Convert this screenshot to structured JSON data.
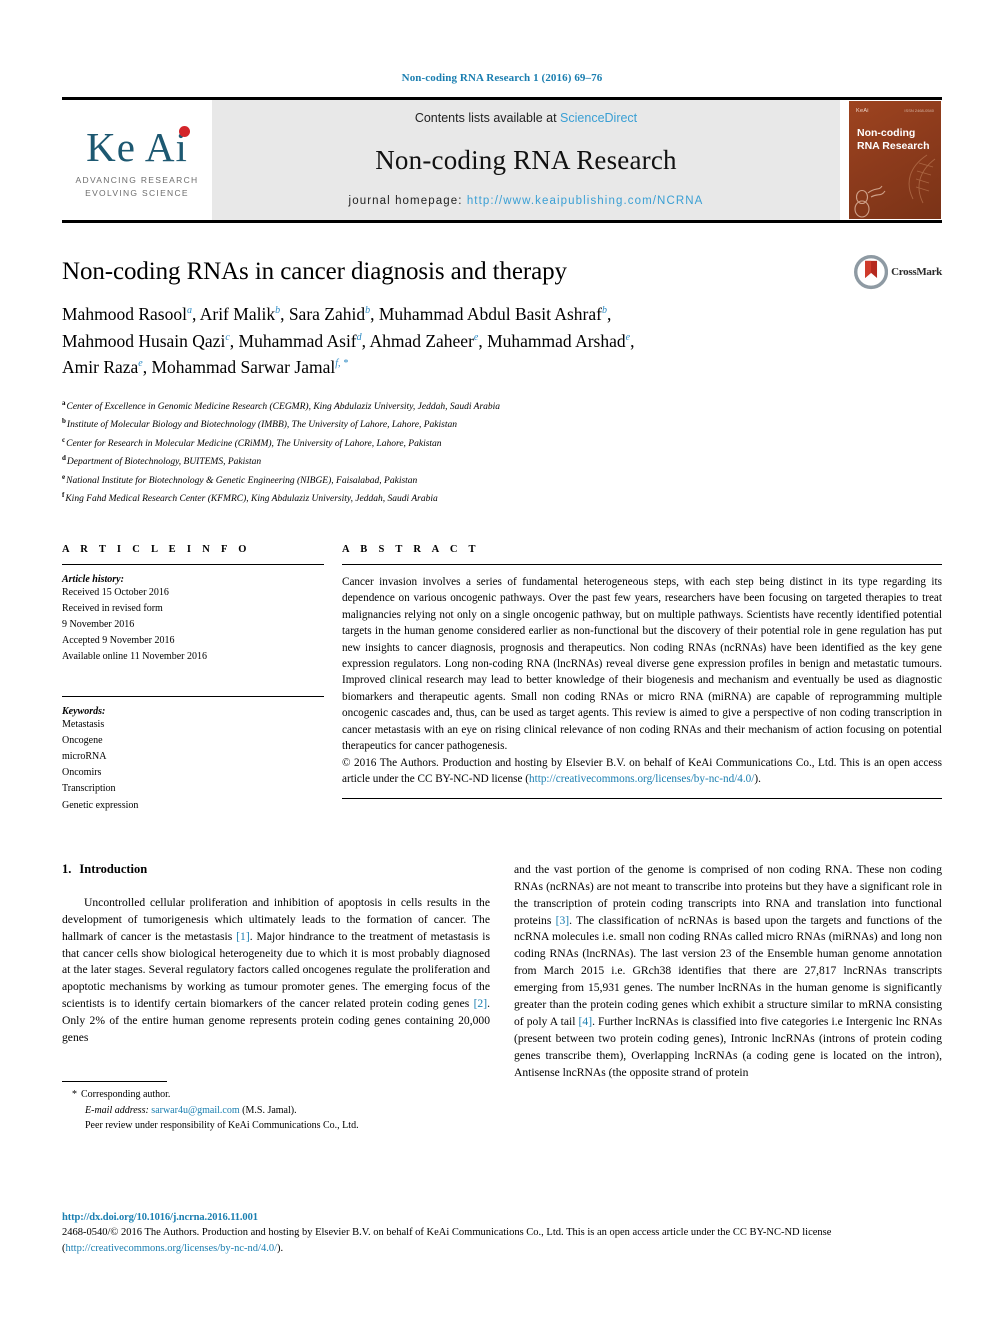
{
  "running_head": "Non-coding RNA Research 1 (2016) 69–76",
  "masthead": {
    "logo": {
      "wordmark": "Ke Ai",
      "tagline_line1": "ADVANCING RESEARCH",
      "tagline_line2": "EVOLVING SCIENCE"
    },
    "contents_prefix": "Contents lists available at ",
    "contents_link": "ScienceDirect",
    "journal_title": "Non-coding RNA Research",
    "homepage_label": "journal homepage: ",
    "homepage_url": "http://www.keaipublishing.com/NCRNA",
    "cover": {
      "publisher": "KeAi",
      "issn": "ISSN 2468-0540",
      "title": "Non-coding RNA Research"
    }
  },
  "article": {
    "title": "Non-coding RNAs in cancer diagnosis and therapy",
    "crossmark_label": "CrossMark",
    "authors_lines": [
      "Mahmood Rasool ᵃ, Arif Malik ᵇ, Sara Zahid ᵇ, Muhammad Abdul Basit Ashraf ᵇ,",
      "Mahmood Husain Qazi ᶜ, Muhammad Asif ᵈ, Ahmad Zaheer ᵉ, Muhammad Arshad ᵉ,",
      "Amir Raza ᵉ, Mohammad Sarwar Jamal ᶠ, *"
    ],
    "authors": [
      {
        "name": "Mahmood Rasool",
        "marks": "a",
        "sep": ", "
      },
      {
        "name": "Arif Malik",
        "marks": "b",
        "sep": ", "
      },
      {
        "name": "Sara Zahid",
        "marks": "b",
        "sep": ", "
      },
      {
        "name": "Muhammad Abdul Basit Ashraf",
        "marks": "b",
        "sep": ","
      },
      {
        "name": "Mahmood Husain Qazi",
        "marks": "c",
        "sep": ", "
      },
      {
        "name": "Muhammad Asif",
        "marks": "d",
        "sep": ", "
      },
      {
        "name": "Ahmad Zaheer",
        "marks": "e",
        "sep": ", "
      },
      {
        "name": "Muhammad Arshad",
        "marks": "e",
        "sep": ","
      },
      {
        "name": "Amir Raza",
        "marks": "e",
        "sep": ", "
      },
      {
        "name": "Mohammad Sarwar Jamal",
        "marks": "f, *",
        "sep": ""
      }
    ],
    "affiliations": [
      {
        "mark": "a",
        "text": "Center of Excellence in Genomic Medicine Research (CEGMR), King Abdulaziz University, Jeddah, Saudi Arabia"
      },
      {
        "mark": "b",
        "text": "Institute of Molecular Biology and Biotechnology (IMBB), The University of Lahore, Lahore, Pakistan"
      },
      {
        "mark": "c",
        "text": "Center for Research in Molecular Medicine (CRiMM), The University of Lahore, Lahore, Pakistan"
      },
      {
        "mark": "d",
        "text": "Department of Biotechnology, BUITEMS, Pakistan"
      },
      {
        "mark": "e",
        "text": "National Institute for Biotechnology & Genetic Engineering (NIBGE), Faisalabad, Pakistan"
      },
      {
        "mark": "f",
        "text": "King Fahd Medical Research Center (KFMRC), King Abdulaziz University, Jeddah, Saudi Arabia"
      }
    ]
  },
  "article_info": {
    "heading": "A R T I C L E  I N F O",
    "history_label": "Article history:",
    "history_lines": [
      "Received 15 October 2016",
      "Received in revised form",
      "9 November 2016",
      "Accepted 9 November 2016",
      "Available online 11 November 2016"
    ],
    "keywords_label": "Keywords:",
    "keywords": [
      "Metastasis",
      "Oncogene",
      "microRNA",
      "Oncomirs",
      "Transcription",
      "Genetic expression"
    ]
  },
  "abstract": {
    "heading": "A B S T R A C T",
    "text": "Cancer invasion involves a series of fundamental heterogeneous steps, with each step being distinct in its type regarding its dependence on various oncogenic pathways. Over the past few years, researchers have been focusing on targeted therapies to treat malignancies relying not only on a single oncogenic pathway, but on multiple pathways. Scientists have recently identified potential targets in the human genome considered earlier as non-functional but the discovery of their potential role in gene regulation has put new insights to cancer diagnosis, prognosis and therapeutics. Non coding RNAs (ncRNAs) have been identified as the key gene expression regulators. Long non-coding RNA (lncRNAs) reveal diverse gene expression profiles in benign and metastatic tumours. Improved clinical research may lead to better knowledge of their biogenesis and mechanism and eventually be used as diagnostic biomarkers and therapeutic agents. Small non coding RNAs or micro RNA (miRNA) are capable of reprogramming multiple oncogenic cascades and, thus, can be used as target agents. This review is aimed to give a perspective of non coding transcription in cancer metastasis with an eye on rising clinical relevance of non coding RNAs and their mechanism of action focusing on potential therapeutics for cancer pathogenesis.",
    "copyright_pre": "© 2016 The Authors. Production and hosting by Elsevier B.V. on behalf of KeAi Communications Co., Ltd. This is an open access article under the CC BY-NC-ND license (",
    "copyright_link": "http://creativecommons.org/licenses/by-nc-nd/4.0/",
    "copyright_post": ")."
  },
  "introduction": {
    "number": "1.",
    "title": "Introduction",
    "left_para_pre": "Uncontrolled cellular proliferation and inhibition of apoptosis in cells results in the development of tumorigenesis which ultimately leads to the formation of cancer. The hallmark of cancer is the metastasis ",
    "ref1": "[1]",
    "left_para_mid": ". Major hindrance to the treatment of metastasis is that cancer cells show biological heterogeneity due to which it is most probably diagnosed at the later stages. Several regulatory factors called oncogenes regulate the proliferation and apoptotic mechanisms by working as tumour promoter genes. The emerging focus of the scientists is to identify certain biomarkers of the cancer related protein coding genes ",
    "ref2": "[2]",
    "left_para_end": ". Only 2% of the entire human genome represents protein coding genes containing 20,000 genes",
    "right_para_pre": "and the vast portion of the genome is comprised of non coding RNA. These non coding RNAs (ncRNAs) are not meant to transcribe into proteins but they have a significant role in the transcription of protein coding transcripts into RNA and translation into functional proteins ",
    "ref3": "[3]",
    "right_para_mid": ". The classification of ncRNAs is based upon the targets and functions of the ncRNA molecules i.e. small non coding RNAs called micro RNAs (miRNAs) and long non coding RNAs (lncRNAs). The last version 23 of the Ensemble human genome annotation from March 2015 i.e. GRch38 identifies that there are 27,817 lncRNAs transcripts emerging from 15,931 genes. The number lncRNAs in the human genome is significantly greater than the protein coding genes which exhibit a structure similar to mRNA consisting of poly A tail ",
    "ref4": "[4]",
    "right_para_end": ". Further lncRNAs is classified into five categories i.e Intergenic lnc RNAs (present between two protein coding genes), Intronic lncRNAs (introns of protein coding genes transcribe them), Overlapping lncRNAs (a coding gene is located on the intron), Antisense lncRNAs (the opposite strand of protein"
  },
  "footnote": {
    "star": "*",
    "corresponding": "Corresponding author.",
    "email_label": "E-mail address:",
    "email": "sarwar4u@gmail.com",
    "email_suffix": "(M.S. Jamal).",
    "peer_review": "Peer review under responsibility of KeAi Communications Co., Ltd."
  },
  "page_footer": {
    "doi": "http://dx.doi.org/10.1016/j.ncrna.2016.11.001",
    "legal_pre": "2468-0540/© 2016 The Authors. Production and hosting by Elsevier B.V. on behalf of KeAi Communications Co., Ltd. This is an open access article under the CC BY-NC-ND license (",
    "legal_link": "http://creativecommons.org/licenses/by-nc-nd/4.0/",
    "legal_post": ")."
  },
  "colors": {
    "link": "#1a7eb0",
    "sciencedirect": "#3a9fd4",
    "keai_teal": "#1d5871",
    "keai_red": "#d3252a",
    "cover_rust": "#8d3b1c",
    "crossmark_red": "#c0392b"
  }
}
